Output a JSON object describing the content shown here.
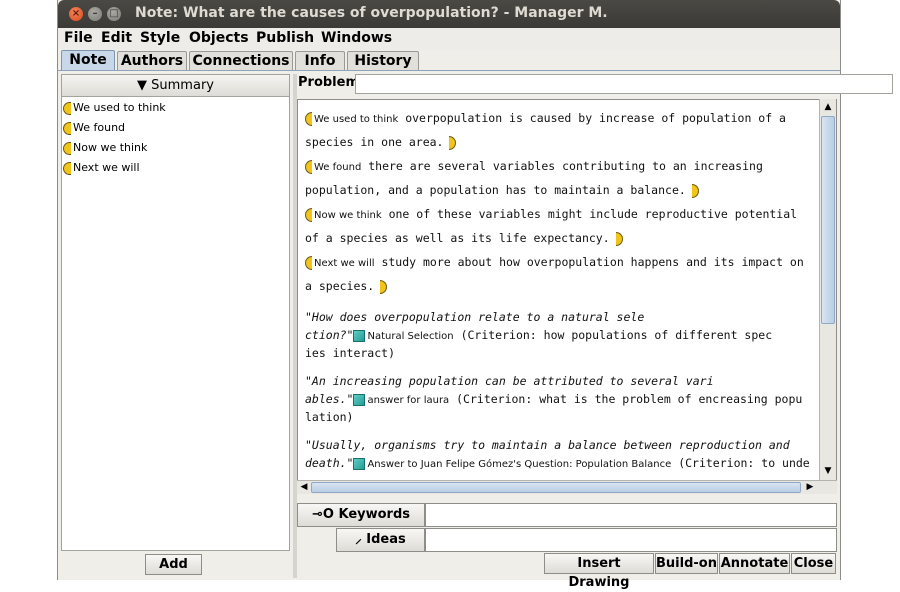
{
  "window": {
    "title": "Note: What are the causes of overpopulation? - Manager M."
  },
  "menu": [
    "File",
    "Edit",
    "Style",
    "Objects",
    "Publish",
    "Windows"
  ],
  "tabs": [
    "Note",
    "Authors",
    "Connections",
    "Info",
    "History"
  ],
  "active_tab": "Note",
  "summary": {
    "header": "Summary",
    "items": [
      "We used to think",
      "We found",
      "Now we think",
      "Next we will"
    ],
    "add_label": "Add"
  },
  "problem": {
    "label": "Problem",
    "value": ""
  },
  "note": {
    "scaffolds": [
      {
        "tag": "We used to think",
        "lines": [
          "overpopulation is caused by increase of population of a",
          "species in one area."
        ]
      },
      {
        "tag": "We found",
        "lines": [
          "there are several variables contributing to an increasing",
          "population, and a population has to maintain a balance."
        ]
      },
      {
        "tag": "Now we think",
        "lines": [
          "one of these variables might include reproductive potential",
          "of a species as well as its life expectancy."
        ]
      },
      {
        "tag": "Next we will",
        "lines": [
          "study more about how overpopulation happens and its impact on",
          "a species."
        ]
      }
    ],
    "quotes": [
      {
        "l1": "\"How does overpopulation relate to a natural sele",
        "l2a": "ction?\"",
        "link": "Natural Selection",
        "l2b": "(Criterion: how populations of different spec",
        "l3": "ies interact)"
      },
      {
        "l1": "\"An increasing population can be attributed to several vari",
        "l2a": "ables.\"",
        "link": "answer for laura",
        "l2b": "(Criterion: what is the problem of encreasing popu",
        "l3": "lation)"
      },
      {
        "l1": "\"Usually, organisms try to maintain a balance between reproduction and",
        "l2a": "death.\"",
        "link": "Answer to Juan Felipe Gómez's Question: Population Balance",
        "l2b": "(Criterion: to unde",
        "l3": ""
      }
    ]
  },
  "keywords": {
    "label": "Keywords",
    "value": ""
  },
  "ideas": {
    "label": "Ideas",
    "value": ""
  },
  "buttons": [
    "Insert Drawing",
    "Build-on",
    "Annotate",
    "Close"
  ]
}
